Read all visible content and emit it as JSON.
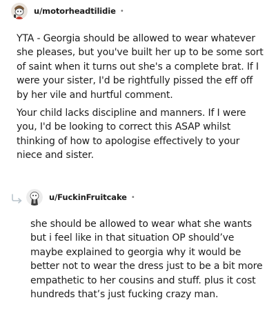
{
  "comment1": {
    "username": "u/motorheadtilidie",
    "separator": "•",
    "paragraphs": [
      "YTA - Georgia should be allowed to wear whatever she pleases, but you've built her up to be some sort of saint when it turns out she's a complete brat. If I were your sister, I'd be rightfully pissed the eff off by her vile and hurtful comment.",
      "Your child lacks discipline and manners. If I were you, I'd be looking to correct this ASAP whilst thinking of how to apologise effectively to your niece and sister."
    ]
  },
  "comment2": {
    "username": "u/FuckinFruitcake",
    "separator": "•",
    "paragraphs": [
      "she should be allowed to wear what she wants but i feel like in that situation OP should’ve maybe explained to georgia why it would be better not to wear the dress just to be a bit more empathetic to her cousins and stuff. plus it cost hundreds that’s just fucking crazy man."
    ]
  },
  "icons": {
    "avatar1": "snoo-avatar-icon",
    "avatar2": "snoo-avatar-icon",
    "reply": "reply-arrow-icon"
  }
}
